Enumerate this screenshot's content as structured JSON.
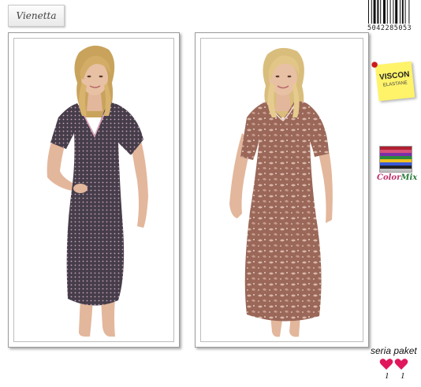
{
  "brand": {
    "logo_text": "Vienetta"
  },
  "barcode": {
    "digits": "5042285053"
  },
  "products": [
    {
      "name": "product-photo-dotted-nightgown",
      "dress_color": "#463d4a",
      "dot_color": "#c9a7b8"
    },
    {
      "name": "product-photo-floral-nightgown",
      "dress_color": "#9a6758",
      "pattern_color": "#d8b7a9"
    }
  ],
  "fabric_tag": {
    "line1": "VISCON",
    "line2": "ELASTANE",
    "note_color": "#fff36a",
    "pin_color": "#d01818"
  },
  "color_mix": {
    "parts": [
      "Color",
      "Mix"
    ],
    "swatch_colors": [
      "#b02030",
      "#d9507a",
      "#7a2fa8",
      "#2a8a3a",
      "#f0c020",
      "#3a5ad8",
      "#222222",
      "#c0c0c0"
    ]
  },
  "package": {
    "label": "seria paket",
    "counts": [
      "1",
      "1"
    ],
    "heart_color": "#e0175c"
  }
}
